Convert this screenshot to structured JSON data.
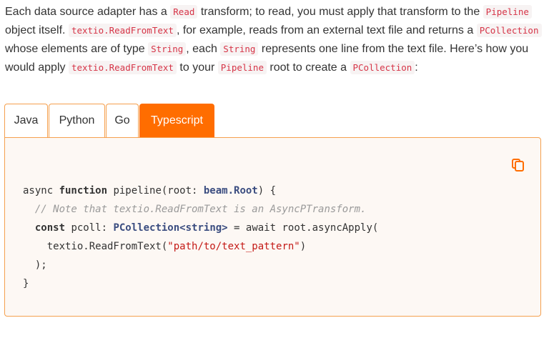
{
  "paragraph": {
    "t1": "Each data source adapter has a ",
    "c1": "Read",
    "t2": " transform; to read, you must apply that transform to the ",
    "c2": "Pipeline",
    "t3": " object itself. ",
    "c3": "textio.ReadFromText",
    "t4": ", for example, reads from an external text file and returns a ",
    "c4": "PCollection",
    "t5": " whose elements are of type ",
    "c5": "String",
    "t6": ", each ",
    "c6": "String",
    "t7": " represents one line from the text file. Here’s how you would apply ",
    "c7": "textio.ReadFromText",
    "t8": " to your ",
    "c8": "Pipeline",
    "t9": " root to create a ",
    "c9": "PCollection",
    "t10": ":"
  },
  "tabs": [
    {
      "label": "Java"
    },
    {
      "label": "Python"
    },
    {
      "label": "Go"
    },
    {
      "label": "Typescript",
      "active": true
    }
  ],
  "code": {
    "l1_a": "async ",
    "l1_b": "function",
    "l1_c": " pipeline(root: ",
    "l1_d": "beam.Root",
    "l1_e": ") {",
    "l2_indent": "  ",
    "l2_comment": "// Note that textio.ReadFromText is an AsyncPTransform.",
    "l3_indent": "  ",
    "l3_a": "const",
    "l3_b": " pcoll: ",
    "l3_c": "PCollection<string>",
    "l3_d": " = await root.asyncApply(",
    "l4_indent": "    ",
    "l4_a": "textio.ReadFromText(",
    "l4_b": "\"path/to/text_pattern\"",
    "l4_c": ")",
    "l5": "  );",
    "l6": "}"
  },
  "colors": {
    "accent": "#ff6d00",
    "border": "#f5a04e",
    "inline_code": "#d63447",
    "type_blue": "#3b4d80",
    "string_red": "#c41a16",
    "comment_gray": "#9a9a9a"
  },
  "icons": {
    "copy": "copy-icon"
  }
}
